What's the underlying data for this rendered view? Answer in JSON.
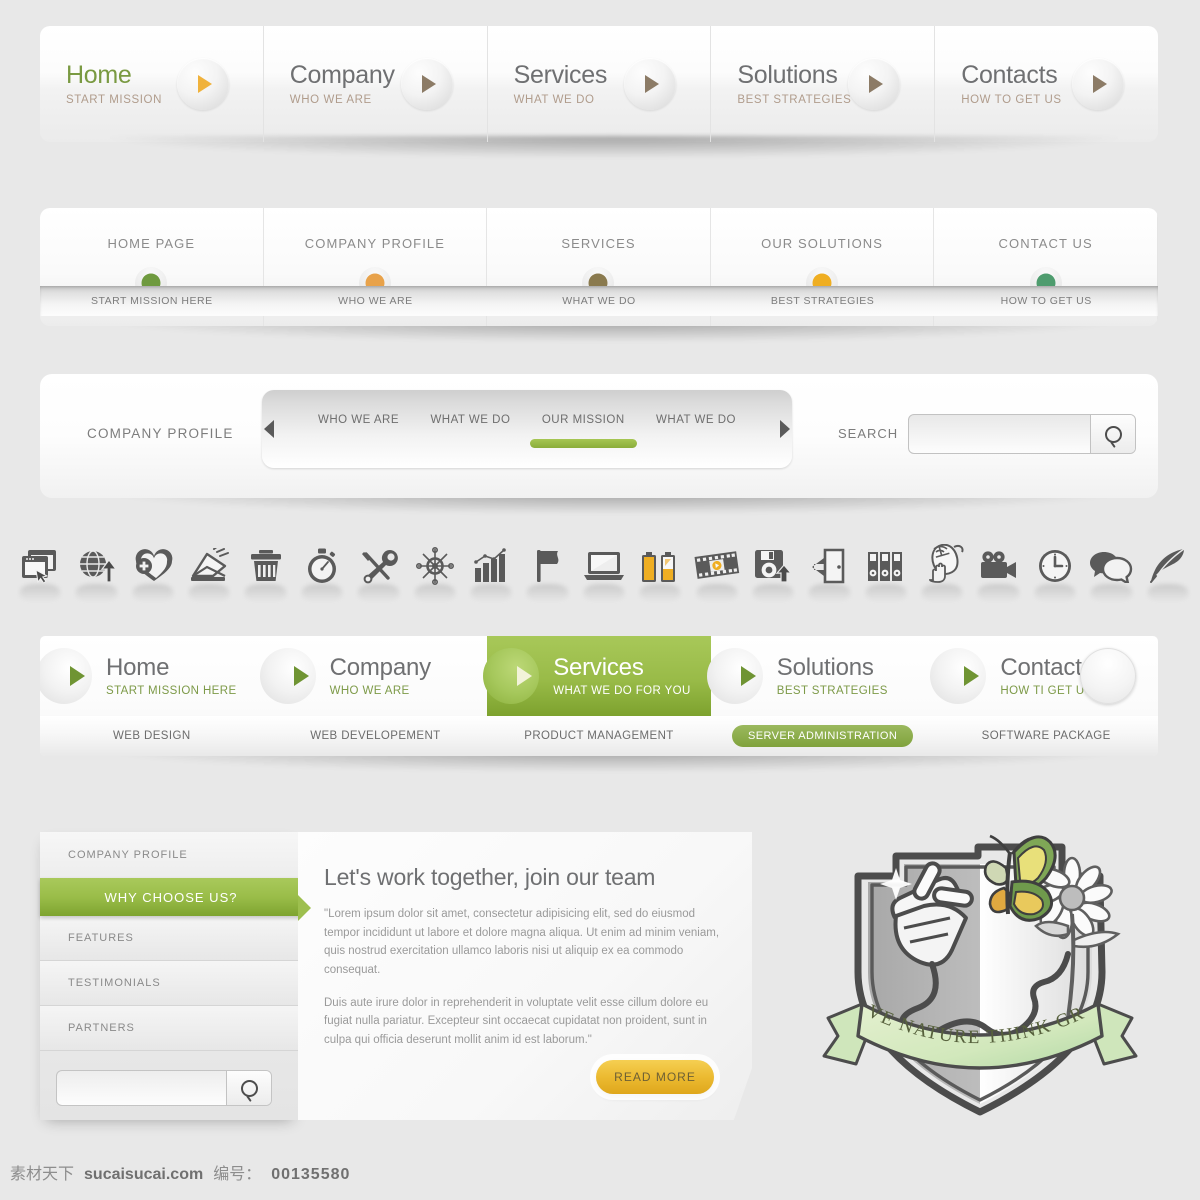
{
  "bar1": {
    "items": [
      {
        "title": "Home",
        "sub": "START MISSION",
        "active": true,
        "icon": "play-triangle-icon"
      },
      {
        "title": "Company",
        "sub": "WHO WE ARE",
        "active": false,
        "icon": "play-triangle-icon"
      },
      {
        "title": "Services",
        "sub": "WHAT WE DO",
        "active": false,
        "icon": "play-triangle-icon"
      },
      {
        "title": "Solutions",
        "sub": "BEST STRATEGIES",
        "active": false,
        "icon": "play-triangle-icon"
      },
      {
        "title": "Contacts",
        "sub": "HOW TO GET US",
        "active": false,
        "icon": "play-triangle-icon"
      }
    ]
  },
  "bar2": {
    "items": [
      {
        "title": "HOME PAGE",
        "sub": "START MISSION HERE",
        "dot": "#6f9a3f"
      },
      {
        "title": "COMPANY PROFILE",
        "sub": "WHO WE ARE",
        "dot": "#e8a24a"
      },
      {
        "title": "SERVICES",
        "sub": "WHAT WE DO",
        "dot": "#8a7a4e"
      },
      {
        "title": "OUR SOLUTIONS",
        "sub": "BEST STRATEGIES",
        "dot": "#efae22"
      },
      {
        "title": "CONTACT US",
        "sub": "HOW TO GET US",
        "dot": "#4e9c6e"
      }
    ]
  },
  "bar3": {
    "label": "COMPANY PROFILE",
    "tabs": [
      {
        "label": "WHO WE ARE",
        "selected": false
      },
      {
        "label": "WHAT WE DO",
        "selected": false
      },
      {
        "label": "OUR MISSION",
        "selected": true
      },
      {
        "label": "WHAT WE DO",
        "selected": false
      }
    ],
    "search_label": "SEARCH",
    "search_value": "",
    "search_placeholder": "",
    "search_icon": "magnifier-icon",
    "prev_icon": "arrow-left-icon",
    "next_icon": "arrow-right-icon"
  },
  "icons": [
    "browser-window-cursor-icon",
    "globe-upload-icon",
    "heart-plus-icon",
    "envelope-send-icon",
    "trash-can-icon",
    "stopwatch-icon",
    "wrench-screwdriver-icon",
    "compass-icon",
    "bar-chart-growth-icon",
    "flag-icon",
    "laptop-icon",
    "battery-icon",
    "film-strip-play-icon",
    "floppy-disk-upload-icon",
    "exit-door-icon",
    "binders-icon",
    "computer-mouse-hand-icon",
    "video-camera-icon",
    "clock-icon",
    "speech-bubbles-icon",
    "quill-feather-icon"
  ],
  "bar4": {
    "items": [
      {
        "title": "Home",
        "sub": "START MISSION HERE",
        "active": false,
        "icon": "play-triangle-icon"
      },
      {
        "title": "Company",
        "sub": "WHO WE ARE",
        "active": false,
        "icon": "play-triangle-icon"
      },
      {
        "title": "Services",
        "sub": "WHAT WE DO FOR YOU",
        "active": true,
        "icon": "play-triangle-icon"
      },
      {
        "title": "Solutions",
        "sub": "BEST STRATEGIES",
        "active": false,
        "icon": "play-triangle-icon"
      },
      {
        "title": "Contact us",
        "sub": "HOW TI GET US",
        "active": false,
        "icon": "play-triangle-icon"
      }
    ],
    "sublinks": [
      {
        "label": "WEB DESIGN",
        "highlight": false
      },
      {
        "label": "WEB DEVELOPEMENT",
        "highlight": false
      },
      {
        "label": "PRODUCT MANAGEMENT",
        "highlight": false
      },
      {
        "label": "SERVER ADMINISTRATION",
        "highlight": true
      },
      {
        "label": "SOFTWARE PACKAGE",
        "highlight": false
      }
    ]
  },
  "panel": {
    "sidebar": {
      "heading": "COMPANY PROFILE",
      "active_item": "WHY CHOOSE US?",
      "items": [
        "FEATURES",
        "TESTIMONIALS",
        "PARTNERS"
      ],
      "search_value": "",
      "search_placeholder": "",
      "search_icon": "magnifier-icon"
    },
    "content": {
      "title": "Let's work together, join our team",
      "paragraph1": "\"Lorem ipsum dolor sit amet, consectetur adipisicing elit, sed do eiusmod tempor incididunt ut labore et dolore magna aliqua. Ut enim ad minim veniam, quis nostrud exercitation ullamco laboris nisi ut aliquip ex ea commodo consequat.",
      "paragraph2": "Duis aute irure dolor in reprehenderit in voluptate velit esse cillum dolore eu fugiat nulla pariatur. Excepteur sint occaecat cupidatat non proident, sunt in culpa qui officia deserunt mollit anim id est laborum.\"",
      "read_more": "READ MORE"
    }
  },
  "emblem": {
    "banner_text": "LOVE NATURE THINK GREEN",
    "name": "shield-plug-butterfly-emblem"
  },
  "footer": {
    "site_cn": "素材天下",
    "site": "sucaisucai.com",
    "id_label": "编号：",
    "id_value": "00135580"
  },
  "colors": {
    "green": "#8aad3a",
    "green_light": "#a8c859",
    "gold": "#ecbb32",
    "orange": "#f0b23c",
    "text_gray": "#6f7072",
    "bg": "#e8e8e8"
  }
}
